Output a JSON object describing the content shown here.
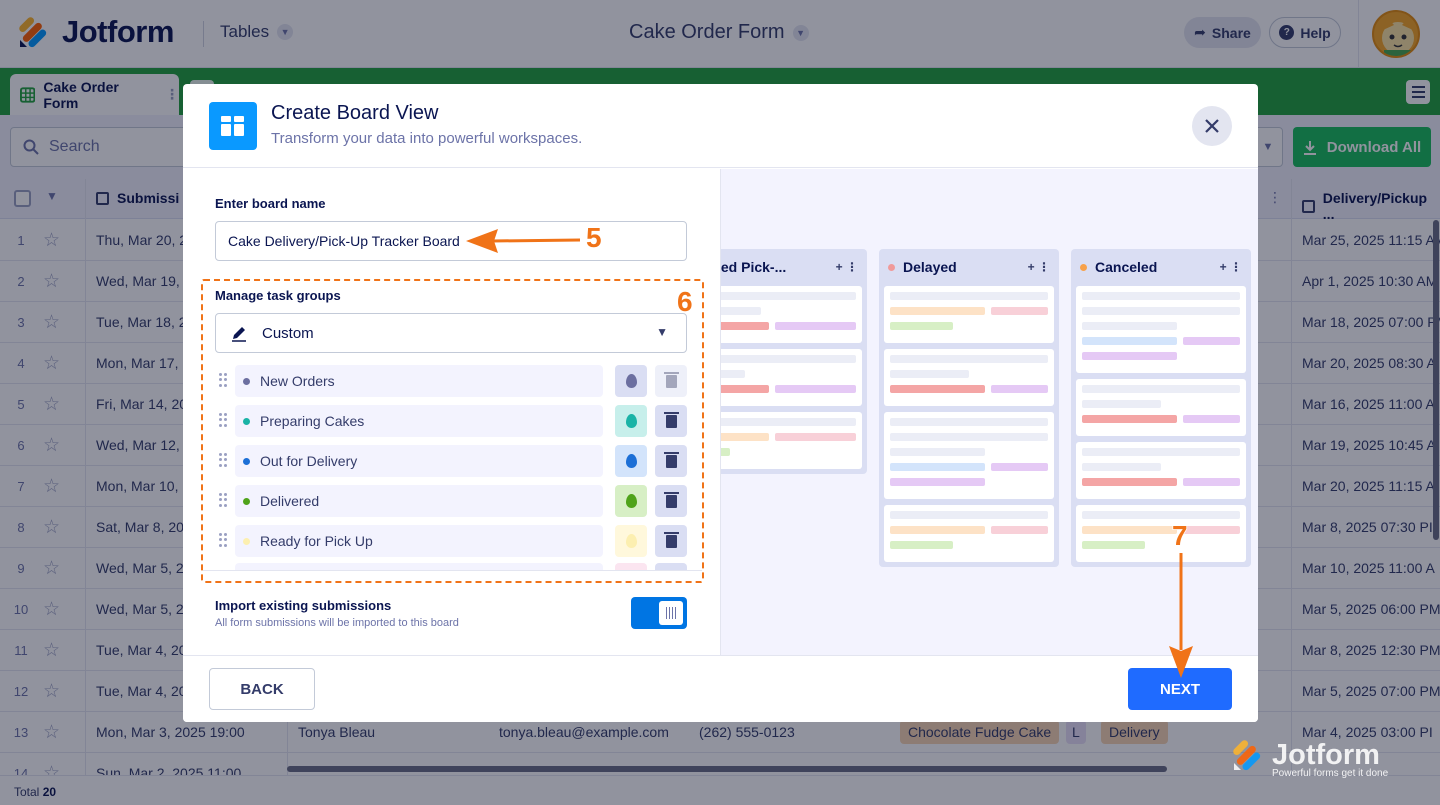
{
  "app": {
    "logo_text": "Jotform",
    "tables_label": "Tables",
    "form_title": "Cake Order Form",
    "share_label": "Share",
    "help_label": "Help"
  },
  "tabs": {
    "active_label": "Cake Order Form"
  },
  "toolbar": {
    "search_placeholder": "Search",
    "download_label": "Download All"
  },
  "table": {
    "col_submission": "Submissi",
    "col_delivery": "Delivery/Pickup ...",
    "rows": [
      {
        "num": "1",
        "submission": "Thu, Mar 20, 2",
        "delivery": "Mar 25, 2025 11:15 AM"
      },
      {
        "num": "2",
        "submission": "Wed, Mar 19,",
        "delivery": "Apr 1, 2025 10:30 AM"
      },
      {
        "num": "3",
        "submission": "Tue, Mar 18, 2",
        "delivery": "Mar 18, 2025 07:00 PM"
      },
      {
        "num": "4",
        "submission": "Mon, Mar 17,",
        "delivery": "Mar 20, 2025 08:30 A"
      },
      {
        "num": "5",
        "submission": "Fri, Mar 14, 20",
        "delivery": "Mar 16, 2025 11:00 A"
      },
      {
        "num": "6",
        "submission": "Wed, Mar 12,",
        "delivery": "Mar 19, 2025 10:45 A"
      },
      {
        "num": "7",
        "submission": "Mon, Mar 10,",
        "delivery": "Mar 20, 2025 11:15 A"
      },
      {
        "num": "8",
        "submission": "Sat, Mar 8, 20",
        "delivery": "Mar 8, 2025 07:30 PI"
      },
      {
        "num": "9",
        "submission": "Wed, Mar 5, 2",
        "delivery": "Mar 10, 2025 11:00 A"
      },
      {
        "num": "10",
        "submission": "Wed, Mar 5, 2",
        "delivery": "Mar 5, 2025 06:00 PM"
      },
      {
        "num": "11",
        "submission": "Tue, Mar 4, 20",
        "delivery": "Mar 8, 2025 12:30 PM"
      },
      {
        "num": "12",
        "submission": "Tue, Mar 4, 20",
        "delivery": "Mar 5, 2025 07:00 PM"
      },
      {
        "num": "13",
        "submission": "Mon, Mar 3, 2025 19:00",
        "delivery": "Mar 4, 2025 03:00 PI",
        "name": "Tonya Bleau",
        "email": "tonya.bleau@example.com",
        "phone": "(262) 555-0123",
        "cake": "Chocolate Fudge Cake",
        "l": "L",
        "type": "Delivery"
      },
      {
        "num": "14",
        "submission": "Sun, Mar 2, 2025 11:00",
        "delivery": ""
      }
    ],
    "total_label": "Total",
    "total_value": "20"
  },
  "modal": {
    "title": "Create Board View",
    "subtitle": "Transform your data into powerful workspaces.",
    "board_name_label": "Enter board name",
    "board_name_value": "Cake Delivery/Pick-Up Tracker Board",
    "manage_label": "Manage task groups",
    "groups_select": "Custom",
    "task_groups": [
      {
        "label": "New Orders",
        "color": "#6c6fa0",
        "drop_bg": "#dadef3",
        "drop_color": "#6c6fa0"
      },
      {
        "label": "Preparing Cakes",
        "color": "#1ab3a6",
        "drop_bg": "#c7efeb",
        "drop_color": "#1ab3a6"
      },
      {
        "label": "Out for Delivery",
        "color": "#1c6fd6",
        "drop_bg": "#d3e4fb",
        "drop_color": "#1c6fd6"
      },
      {
        "label": "Delivered",
        "color": "#4fa31a",
        "drop_bg": "#d7efc5",
        "drop_color": "#4fa31a"
      },
      {
        "label": "Ready for Pick Up",
        "color": "#fcefb0",
        "drop_bg": "#fff8dc",
        "drop_color": "#fcefb0"
      }
    ],
    "import_title": "Import existing submissions",
    "import_sub": "All form submissions will be imported to this board",
    "import_enabled": true,
    "back_label": "BACK",
    "next_label": "NEXT",
    "preview_columns": [
      {
        "label": "pleted Pick-...",
        "dot": ""
      },
      {
        "label": "Delayed",
        "dot": "#f09a9a"
      },
      {
        "label": "Canceled",
        "dot": "#f7a14a"
      }
    ]
  },
  "annotations": {
    "step5": "5",
    "step6": "6",
    "step7": "7",
    "color": "#f07318"
  },
  "watermark": {
    "text": "Jotform",
    "tagline": "Powerful forms get it done"
  }
}
